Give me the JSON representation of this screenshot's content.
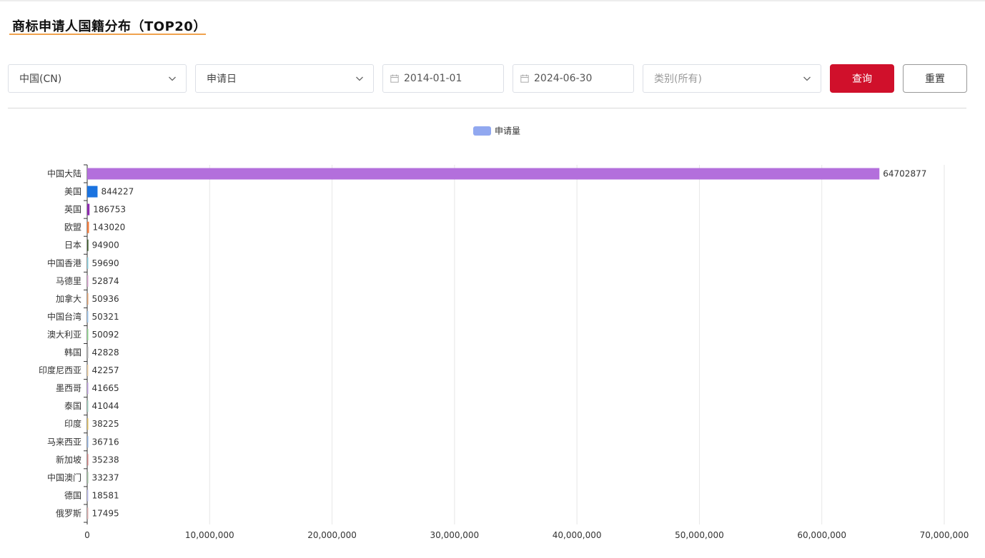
{
  "header": {
    "title": "商标申请人国籍分布（TOP20）"
  },
  "filters": {
    "country": "中国(CN)",
    "date_type": "申请日",
    "start_date": "2014-01-01",
    "end_date": "2024-06-30",
    "category_placeholder": "类别(所有)",
    "query_label": "查询",
    "reset_label": "重置"
  },
  "colors": {
    "accent": "#d0102b",
    "title_underline": "#f0a24d",
    "legend": "#91a8f0"
  },
  "chart_data": {
    "type": "bar",
    "orientation": "horizontal",
    "legend": {
      "entries": [
        "申请量"
      ],
      "placement": "top-center"
    },
    "xlim": [
      0,
      70000000
    ],
    "xticks": [
      0,
      10000000,
      20000000,
      30000000,
      40000000,
      50000000,
      60000000,
      70000000
    ],
    "xtick_labels": [
      "0",
      "10,000,000",
      "20,000,000",
      "30,000,000",
      "40,000,000",
      "50,000,000",
      "60,000,000",
      "70,000,000"
    ],
    "grid": "vertical",
    "series": [
      {
        "name": "申请量",
        "categories": [
          "中国大陆",
          "美国",
          "英国",
          "欧盟",
          "日本",
          "中国香港",
          "马德里",
          "加拿大",
          "中国台湾",
          "澳大利亚",
          "韩国",
          "印度尼西亚",
          "墨西哥",
          "泰国",
          "印度",
          "马来西亚",
          "新加坡",
          "中国澳门",
          "德国",
          "俄罗斯"
        ],
        "values": [
          64702877,
          844227,
          186753,
          143020,
          94900,
          59690,
          52874,
          50936,
          50321,
          50092,
          42828,
          42257,
          41665,
          41044,
          38225,
          36716,
          35238,
          33237,
          18581,
          17495
        ],
        "colors": [
          "#b36fdc",
          "#1a73e0",
          "#8e2cb0",
          "#f07a3c",
          "#3a5a2a",
          "#8ad0e0",
          "#d9a3d0",
          "#e0a070",
          "#9fc8f0",
          "#8fd98f",
          "#b0b0b0",
          "#f0d0a0",
          "#c0a0e0",
          "#a0d0c0",
          "#e0c060",
          "#90b0e0",
          "#d08080",
          "#a0c0a0",
          "#c0c0f0",
          "#e0b0b0"
        ]
      }
    ]
  }
}
